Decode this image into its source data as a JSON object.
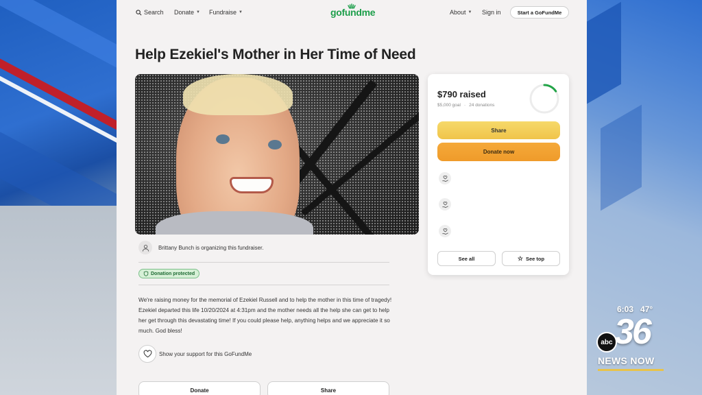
{
  "nav": {
    "search_label": "Search",
    "donate_label": "Donate",
    "fundraise_label": "Fundraise",
    "logo_text": "gofundme",
    "about_label": "About",
    "signin_label": "Sign in",
    "start_label": "Start a GoFundMe"
  },
  "campaign": {
    "title": "Help Ezekiel's Mother in Her Time of Need",
    "organizer_text": "Brittany Bunch is organizing this fundraiser.",
    "badge_label": "Donation protected",
    "story": "We're raising money for the memorial of Ezekiel Russell and to help the mother in this time of tragedy! Ezekiel departed this life 10/20/2024 at 4:31pm and the mother needs all the help she can get to help her get through this devastating time! If you could please help, anything helps and we appreciate it so much. God bless!",
    "support_label": "Show your support for this GoFundMe",
    "bottom_donate_label": "Donate",
    "bottom_share_label": "Share"
  },
  "donation_card": {
    "raised": "$790 raised",
    "goal": "$5,000 goal",
    "separator": "·",
    "donations": "24 donations",
    "progress_fraction": 0.158,
    "share_label": "Share",
    "donate_label": "Donate now",
    "see_all_label": "See all",
    "see_top_label": "See top"
  },
  "broadcast": {
    "time": "6:03",
    "temperature": "47°",
    "network": "abc",
    "channel": "36",
    "brand": "NEWS NOW"
  },
  "colors": {
    "brand_green": "#1c9e4a",
    "share_yellow": "#f0c44a",
    "donate_orange": "#ef9b2a",
    "progress_green": "#22a447"
  }
}
